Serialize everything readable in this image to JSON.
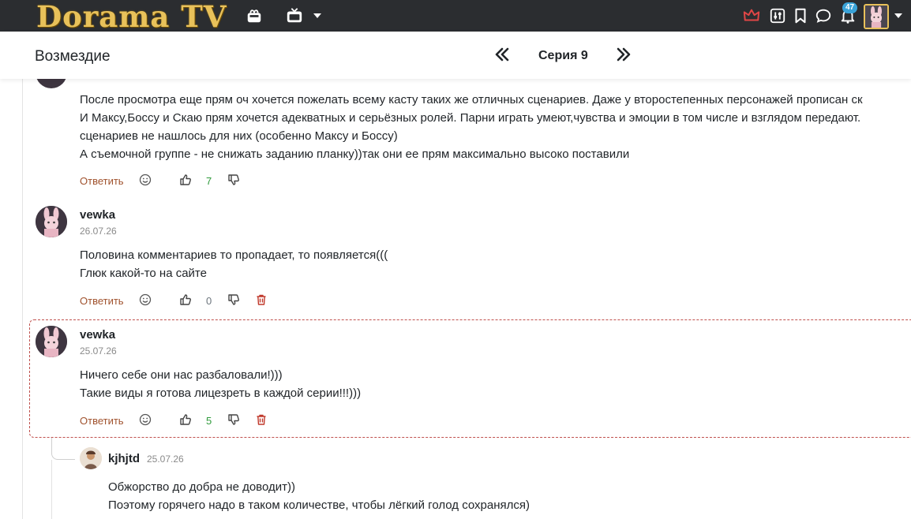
{
  "header": {
    "logo_text": "Dorama TV",
    "notification_count": "47",
    "icons": [
      "gift-icon",
      "tv-icon",
      "crown-icon",
      "sliders-icon",
      "bookmark-icon",
      "chat-icon",
      "bell-icon"
    ],
    "crown_color": "#e04646",
    "logo_color": "#e8c15a"
  },
  "titlebar": {
    "show_title": "Возмездие",
    "episode_label": "Серия 9"
  },
  "comments": [
    {
      "lines": [
        "После просмотра еще прям оч хочется пожелать всему касту таких же отличных сценариев. Даже у второстепенных персонажей прописан ск",
        "И Максу,Боссу и Скаю прям хочется адекватных и серьёзных ролей. Парни играть умеют,чувства и эмоции в том числе и взглядом передают.",
        "сценариев не нашлось для них (особенно Максу и Боссу)",
        "А съемочной группе - не снижать заданию планку))так они ее прям максимально высоко поставили"
      ],
      "reply_label": "Ответить",
      "likes": "7"
    },
    {
      "user": "vewka",
      "date": "26.07.26",
      "lines": [
        "Половина комментариев то пропадает, то появляется(((",
        "Глюк какой-то на сайте"
      ],
      "reply_label": "Ответить",
      "likes": "0"
    },
    {
      "user": "vewka",
      "date": "25.07.26",
      "lines": [
        "Ничего себе они нас разбаловали!)))",
        "Такие виды я готова лицезреть в каждой серии!!!)))"
      ],
      "reply_label": "Ответить",
      "likes": "5"
    },
    {
      "user": "kjhjtd",
      "date": "25.07.26",
      "lines": [
        "Обжорство до добра не доводит))",
        "Поэтому горячего надо в таком количестве, чтобы лёгкий голод сохранялся)"
      ]
    }
  ]
}
